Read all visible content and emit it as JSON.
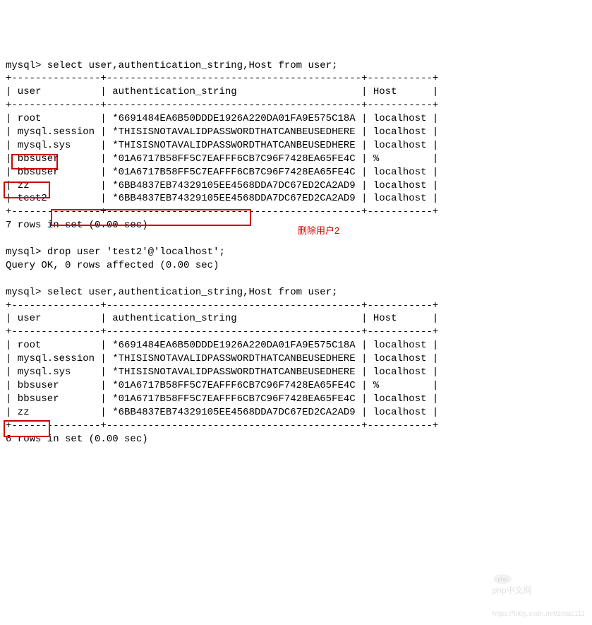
{
  "prompt": "mysql>",
  "query1": "select user,authentication_string,Host from user;",
  "table1": {
    "border_top": "+---------------+-------------------------------------------+-----------+",
    "header": "| user          | authentication_string                     | Host      |",
    "border_mid": "+---------------+-------------------------------------------+-----------+",
    "rows": [
      "| root          | *6691484EA6B50DDDE1926A220DA01FA9E575C18A | localhost |",
      "| mysql.session | *THISISNOTAVALIDPASSWORDTHATCANBEUSEDHERE | localhost |",
      "| mysql.sys     | *THISISNOTAVALIDPASSWORDTHATCANBEUSEDHERE | localhost |",
      "| bbsuser       | *01A6717B58FF5C7EAFFF6CB7C96F7428EA65FE4C | %         |",
      "| bbsuser       | *01A6717B58FF5C7EAFFF6CB7C96F7428EA65FE4C | localhost |",
      "| zz            | *6BB4837EB74329105EE4568DDA7DC67ED2CA2AD9 | localhost |",
      "| test2         | *6BB4837EB74329105EE4568DDA7DC67ED2CA2AD9 | localhost |"
    ],
    "border_bot": "+---------------+-------------------------------------------+-----------+",
    "summary": "7 rows in set (0.00 sec)"
  },
  "query2": "drop user 'test2'@'localhost';",
  "result2": "Query OK, 0 rows affected (0.00 sec)",
  "annotation": "删除用户2",
  "query3": "select user,authentication_string,Host from user;",
  "table2": {
    "border_top": "+---------------+-------------------------------------------+-----------+",
    "header": "| user          | authentication_string                     | Host      |",
    "border_mid": "+---------------+-------------------------------------------+-----------+",
    "rows": [
      "| root          | *6691484EA6B50DDDE1926A220DA01FA9E575C18A | localhost |",
      "| mysql.session | *THISISNOTAVALIDPASSWORDTHATCANBEUSEDHERE | localhost |",
      "| mysql.sys     | *THISISNOTAVALIDPASSWORDTHATCANBEUSEDHERE | localhost |",
      "| bbsuser       | *01A6717B58FF5C7EAFFF6CB7C96F7428EA65FE4C | %         |",
      "| bbsuser       | *01A6717B58FF5C7EAFFF6CB7C96F7428EA65FE4C | localhost |",
      "| zz            | *6BB4837EB74329105EE4568DDA7DC67ED2CA2AD9 | localhost |"
    ],
    "border_bot": "+---------------+-------------------------------------------+-----------+",
    "summary": "6 rows in set (0.00 sec)"
  },
  "watermark1": "php中文网",
  "watermark_url": "https://blog.csdn.net/zmac111"
}
